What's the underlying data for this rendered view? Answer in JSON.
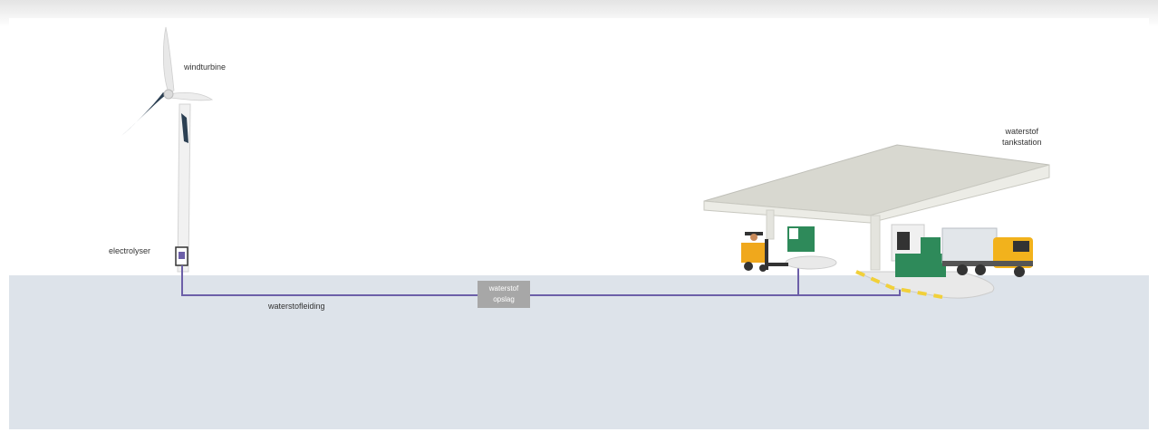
{
  "labels": {
    "windturbine": "windturbine",
    "electrolyser": "electrolyser",
    "pipeline": "waterstofleiding",
    "storage_line1": "waterstof",
    "storage_line2": "opslag",
    "station_line1": "waterstof",
    "station_line2": "tankstation"
  },
  "colors": {
    "ground": "#dde3ea",
    "pipeline": "#6c5fa8",
    "canopy": "#dcdcd4",
    "blade": "#2b3f52",
    "dispenser": "#2e8a5a",
    "truck_cab": "#f2b21c",
    "forklift": "#f0a81c",
    "curb_yellow": "#f1d03a"
  },
  "icons": [
    "wind-turbine-icon",
    "electrolyser-icon",
    "forklift-icon",
    "truck-icon",
    "fuel-dispenser-icon",
    "fuel-station-canopy-icon"
  ]
}
